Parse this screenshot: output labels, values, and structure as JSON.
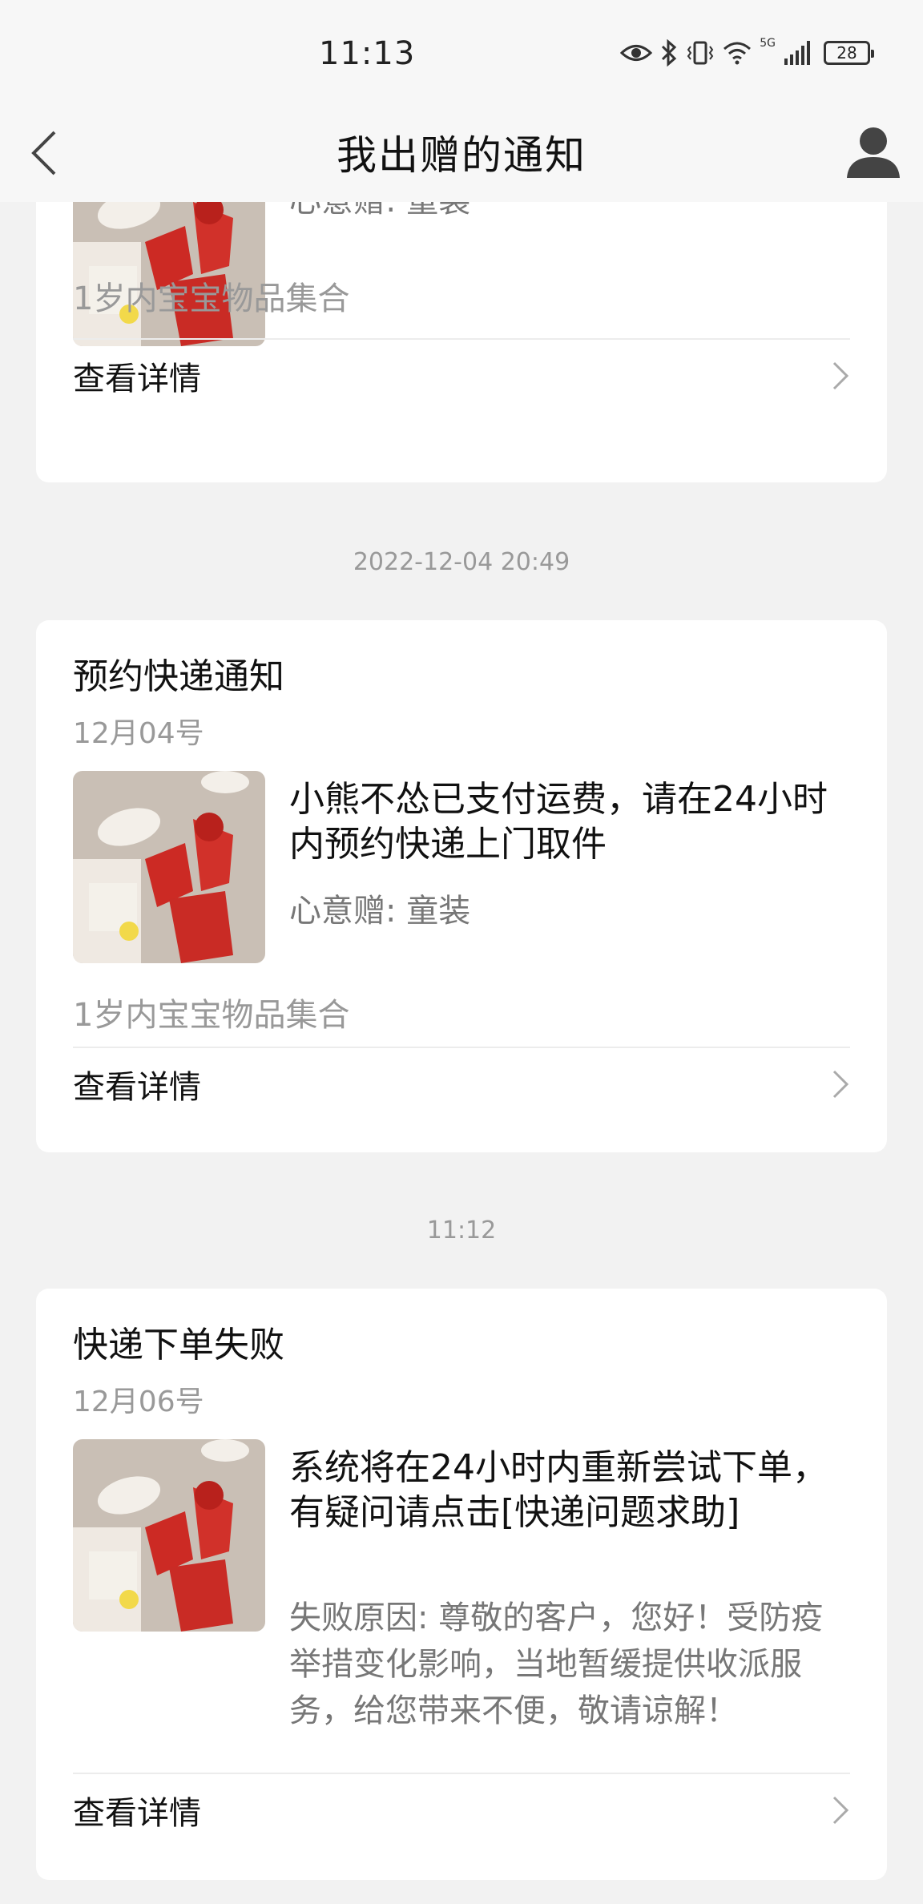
{
  "status_bar": {
    "time": "11:13",
    "network": "5G",
    "battery": "28"
  },
  "nav": {
    "title": "我出赠的通知"
  },
  "icons": {
    "back": "back-chevron-icon",
    "user": "user-avatar-icon",
    "chevron": "chevron-right-icon"
  },
  "cards": [
    {
      "sub": "心意赠: 童装",
      "item_name": "1岁内宝宝物品集合",
      "detail_label": "查看详情"
    },
    {
      "timestamp": "2022-12-04 20:49",
      "title": "预约快递通知",
      "date": "12月04号",
      "msg": "小熊不怂已支付运费，请在24小时内预约快递上门取件",
      "sub": "心意赠: 童装",
      "item_name": "1岁内宝宝物品集合",
      "detail_label": "查看详情"
    },
    {
      "timestamp": "11:12",
      "title": "快递下单失败",
      "date": "12月06号",
      "msg": "系统将在24小时内重新尝试下单，有疑问请点击[快递问题求助]",
      "sub": "失败原因: 尊敬的客户，您好！受防疫举措变化影响，当地暂缓提供收派服务，给您带来不便，敬请谅解！",
      "detail_label": "查看详情"
    }
  ]
}
